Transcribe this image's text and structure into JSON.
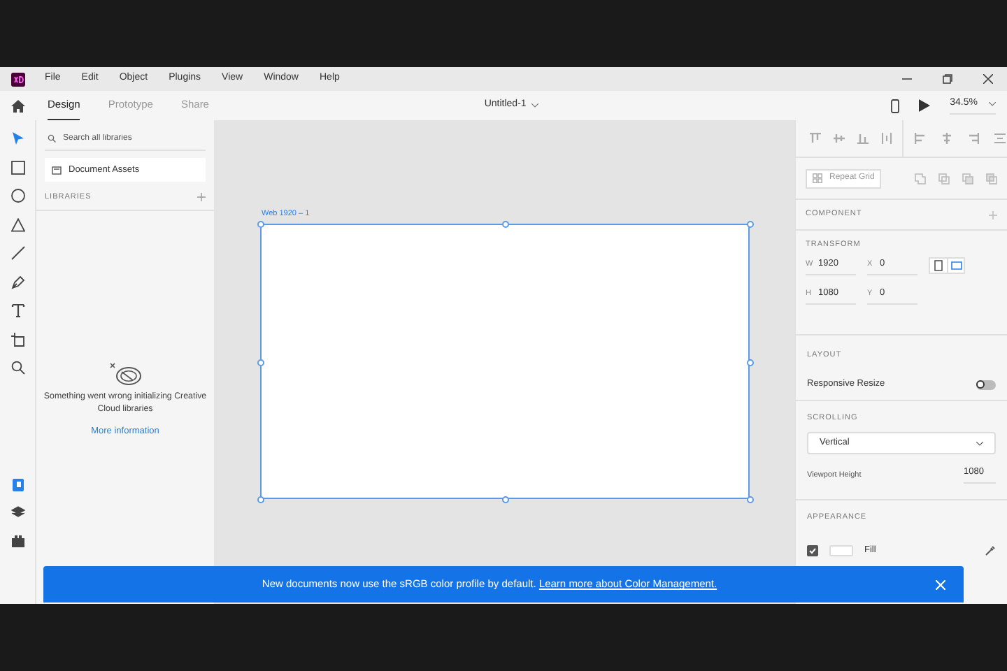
{
  "menu": [
    "File",
    "Edit",
    "Object",
    "Plugins",
    "View",
    "Window",
    "Help"
  ],
  "tabs": [
    {
      "label": "Design",
      "selected": true
    },
    {
      "label": "Prototype",
      "selected": false
    },
    {
      "label": "Share",
      "selected": false
    }
  ],
  "document": {
    "title": "Untitled-1",
    "zoom": "34.5%"
  },
  "tools": [
    {
      "kind": "select",
      "selected": true
    },
    {
      "kind": "rectangle",
      "selected": false
    },
    {
      "kind": "ellipse",
      "selected": false
    },
    {
      "kind": "triangle",
      "selected": false
    },
    {
      "kind": "line",
      "selected": false
    },
    {
      "kind": "pen",
      "selected": false
    },
    {
      "kind": "text",
      "selected": false
    },
    {
      "kind": "artboard",
      "selected": false
    },
    {
      "kind": "zoom",
      "selected": false
    }
  ],
  "bottom_tools": [
    {
      "kind": "libraries",
      "selected": true
    },
    {
      "kind": "layers",
      "selected": false
    },
    {
      "kind": "plugins",
      "selected": false
    }
  ],
  "libraries": {
    "search_placeholder": "Search all libraries",
    "document_assets": "Document Assets",
    "heading": "LIBRARIES",
    "error": "Something went wrong initializing Creative Cloud libraries",
    "link": "More information"
  },
  "artboard": {
    "label": "Web 1920 – 1"
  },
  "inspector": {
    "repeat_grid": "Repeat Grid",
    "component": "COMPONENT",
    "transform": {
      "heading": "TRANSFORM",
      "fields": [
        {
          "label": "W",
          "value": "1920"
        },
        {
          "label": "X",
          "value": "0"
        },
        {
          "label": "H",
          "value": "1080"
        },
        {
          "label": "Y",
          "value": "0"
        }
      ],
      "orientations": [
        {
          "kind": "portrait",
          "selected": false
        },
        {
          "kind": "landscape",
          "selected": true
        }
      ]
    },
    "layout": {
      "heading": "LAYOUT",
      "label": "Responsive Resize",
      "on": false
    },
    "scrolling": {
      "heading": "SCROLLING",
      "value": "Vertical",
      "viewport_label": "Viewport Height",
      "viewport_value": "1080"
    },
    "appearance": {
      "heading": "APPEARANCE",
      "fill_label": "Fill",
      "checked": true
    }
  },
  "notification": {
    "text": "New documents now use the sRGB color profile by default.",
    "link": "Learn more about Color Management."
  }
}
